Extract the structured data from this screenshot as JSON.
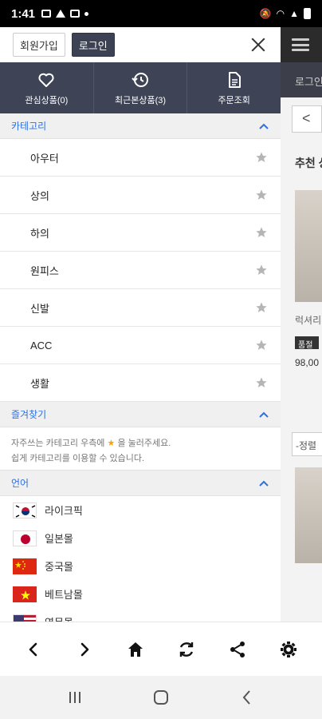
{
  "status": {
    "time": "1:41"
  },
  "background_page": {
    "nav_text": "로그인",
    "back_label": "<",
    "recommend_text": "추천 상",
    "product_name": "럭셔리",
    "badge": "품절",
    "price": "98,00",
    "sort_label": "-정렬"
  },
  "drawer": {
    "join_label": "회원가입",
    "login_label": "로그인",
    "quick": [
      {
        "label": "관심상품(0)",
        "icon": "heart-icon"
      },
      {
        "label": "최근본상품(3)",
        "icon": "history-icon"
      },
      {
        "label": "주문조회",
        "icon": "document-icon"
      }
    ],
    "category_title": "카테고리",
    "categories": [
      "아우터",
      "상의",
      "하의",
      "원피스",
      "신발",
      "ACC",
      "생활"
    ],
    "favorites_title": "즐겨찾기",
    "favorites_line1_a": "자주쓰는 카테고리 우측에",
    "favorites_line1_b": "을 눌러주세요.",
    "favorites_line2": "쉽게 카테고리를 이용할 수 있습니다.",
    "language_title": "언어",
    "languages": [
      {
        "label": "라이크픽",
        "flag": "korea-flag"
      },
      {
        "label": "일본몰",
        "flag": "japan-flag"
      },
      {
        "label": "중국몰",
        "flag": "china-flag"
      },
      {
        "label": "베트남몰",
        "flag": "vietnam-flag"
      },
      {
        "label": "영문몰",
        "flag": "usa-flag"
      }
    ]
  },
  "colors": {
    "accent_blue": "#2f6fde",
    "quick_bar_bg": "#3e4455",
    "star_gold": "#f2a800",
    "star_gray": "#b5b5b5"
  }
}
